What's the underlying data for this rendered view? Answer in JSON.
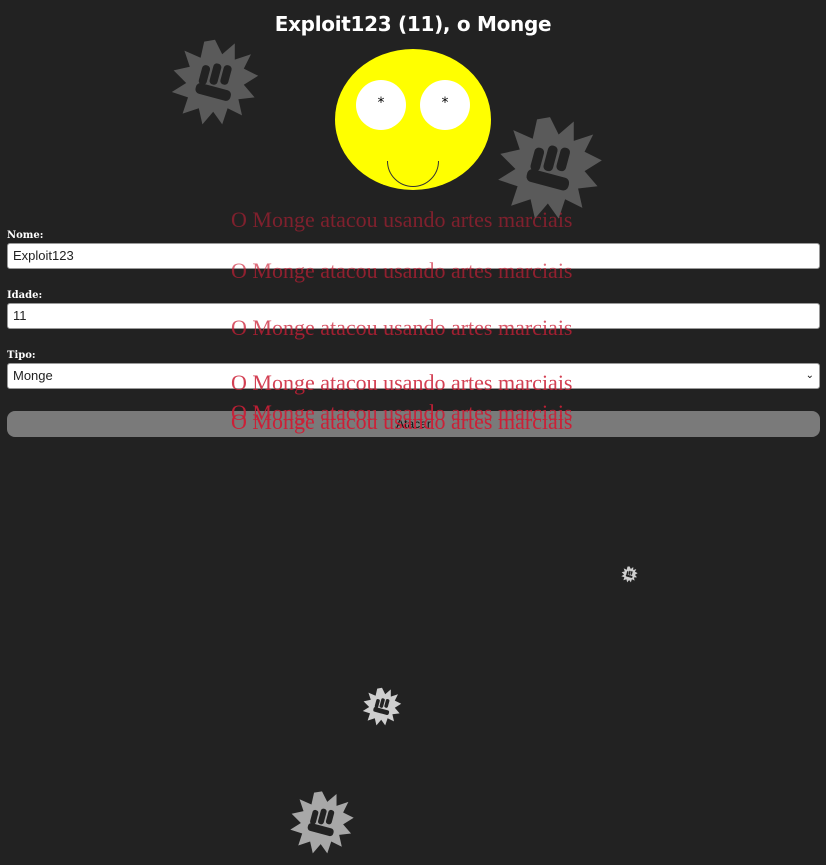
{
  "header": {
    "title": "Exploit123 (11), o Monge"
  },
  "face": {
    "left_eye": "*",
    "right_eye": "*"
  },
  "form": {
    "name_label": "Nome:",
    "name_value": "Exploit123",
    "age_label": "Idade:",
    "age_value": "11",
    "type_label": "Tipo:",
    "type_value": "Monge",
    "attack_button": "Atacar"
  },
  "attack_messages": [
    "O Monge atacou usando artes marciais",
    "O Monge atacou usando artes marciais",
    "O Monge atacou usando artes marciais",
    "O Monge atacou usando artes marciais",
    "O Monge atacou usando artes marciais",
    "O Monge atacou usando artes marciais"
  ],
  "colors": {
    "background": "#222222",
    "face": "#ffff00",
    "message": "#cc1f36",
    "button": "#7a7a7a",
    "punch_icon": "#5a5a5a"
  },
  "icons": [
    "fist-burst-icon"
  ]
}
